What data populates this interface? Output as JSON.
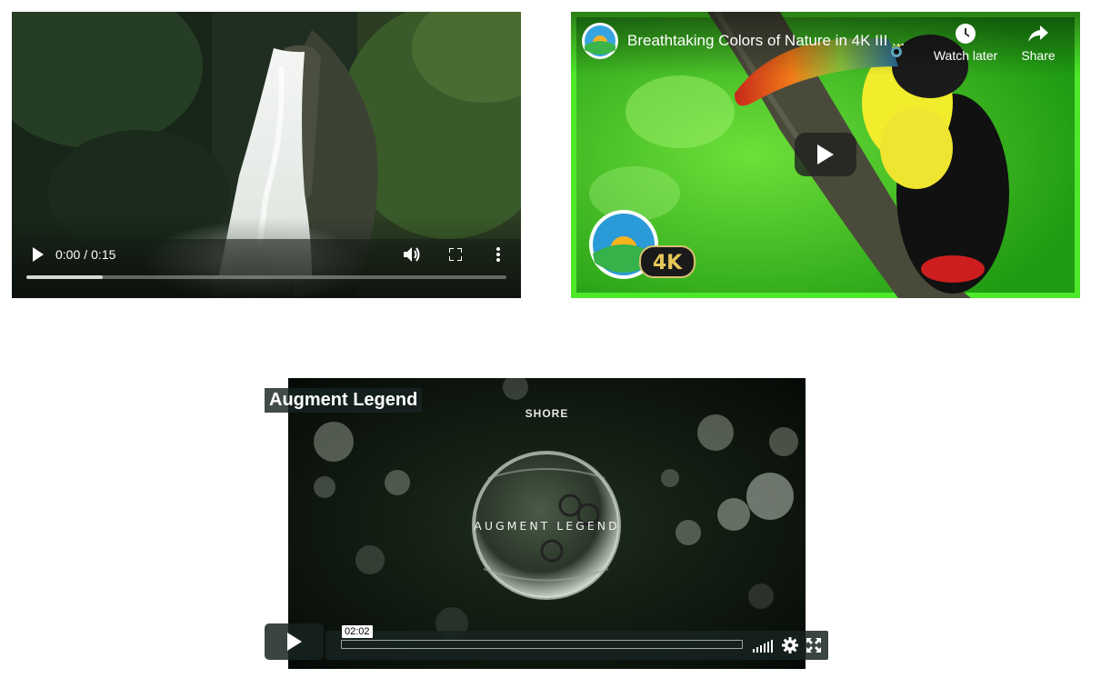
{
  "native_player": {
    "current_time": "0:00",
    "duration": "0:15",
    "buffered_fraction": 0.16
  },
  "youtube_player": {
    "title": "Breathtaking Colors of Nature in 4K III ...",
    "watch_later_label": "Watch later",
    "share_label": "Share",
    "badge_text": "4K"
  },
  "vimeo_player": {
    "title": "Augment Legend",
    "brand_text": "SHORE",
    "center_title": "AUGMENT LEGEND",
    "time_tooltip": "02:02"
  },
  "icons": {
    "native": [
      "play-icon",
      "volume-icon",
      "fullscreen-icon",
      "more-vert-icon"
    ],
    "youtube": [
      "channel-avatar-icon",
      "clock-icon",
      "share-arrow-icon",
      "play-icon"
    ],
    "vimeo": [
      "play-icon",
      "volume-bars-icon",
      "gear-icon",
      "fullscreen-icon"
    ]
  },
  "colors": {
    "youtube_frame": "#4de82a",
    "vimeo_bar": "#172322"
  }
}
